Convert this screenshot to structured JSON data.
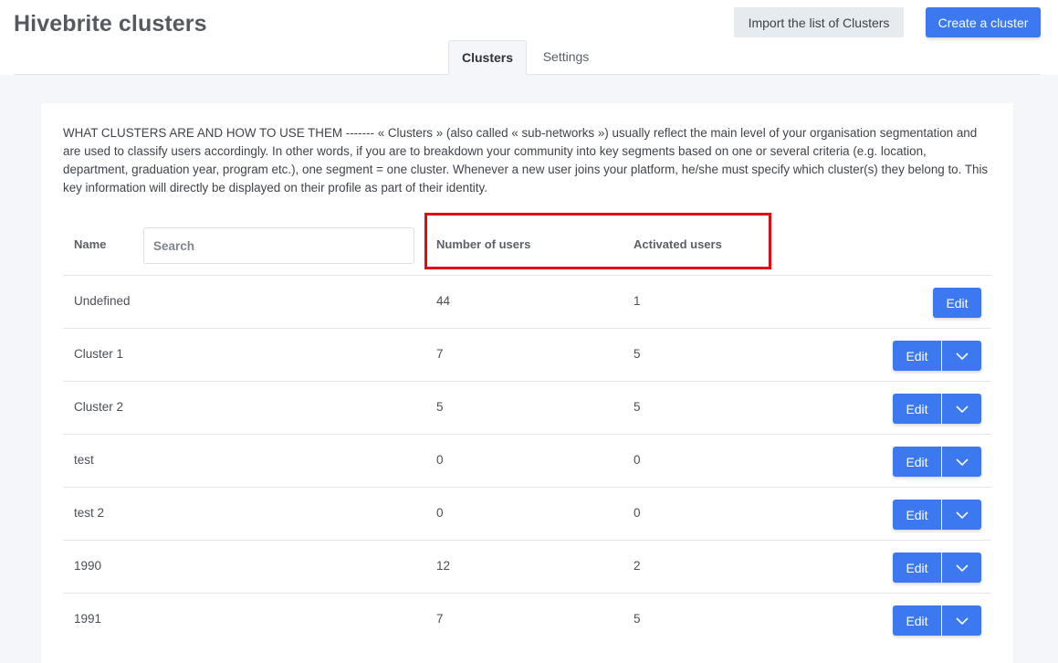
{
  "header": {
    "title": "Hivebrite clusters",
    "import_label": "Import the list of Clusters",
    "create_label": "Create a cluster"
  },
  "tabs": [
    {
      "label": "Clusters",
      "active": true
    },
    {
      "label": "Settings",
      "active": false
    }
  ],
  "description": "WHAT CLUSTERS ARE AND HOW TO USE THEM ------- « Clusters » (also called « sub-networks ») usually reflect the main level of your organisation segmentation and are used to classify users accordingly. In other words, if you are to breakdown your community into key segments based on one or several criteria (e.g. location, department, graduation year, program etc.), one segment = one cluster. Whenever a new user joins your platform, he/she must specify which cluster(s) they belong to. This key information will directly be displayed on their profile as part of their identity.",
  "table": {
    "headers": {
      "name": "Name",
      "users": "Number of users",
      "activated": "Activated users"
    },
    "search_placeholder": "Search",
    "edit_label": "Edit",
    "rows": [
      {
        "name": "Undefined",
        "users": "44",
        "activated": "1"
      },
      {
        "name": "Cluster 1",
        "users": "7",
        "activated": "5"
      },
      {
        "name": "Cluster 2",
        "users": "5",
        "activated": "5"
      },
      {
        "name": "test",
        "users": "0",
        "activated": "0"
      },
      {
        "name": "test 2",
        "users": "0",
        "activated": "0"
      },
      {
        "name": "1990",
        "users": "12",
        "activated": "2"
      },
      {
        "name": "1991",
        "users": "7",
        "activated": "5"
      }
    ]
  },
  "colors": {
    "primary": "#3c78f0",
    "highlight": "#e50914",
    "background": "#f4f6f9"
  },
  "icons": {
    "dropdown": "chevron-down-icon"
  }
}
